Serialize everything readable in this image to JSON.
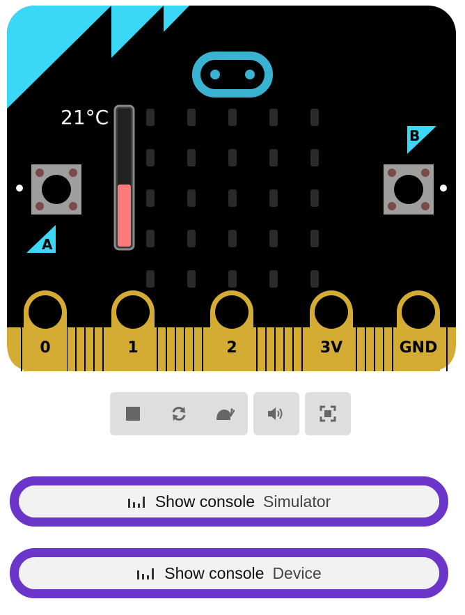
{
  "simulator": {
    "temperature_label": "21°C",
    "temperature_level": 0.45,
    "button_a_label": "A",
    "button_b_label": "B",
    "pins": [
      "0",
      "1",
      "2",
      "3V",
      "GND"
    ],
    "colors": {
      "board": "#000000",
      "accent": "#3ad7f6",
      "gold": "#d4ac33",
      "led_off": "#2a2a2a",
      "thermometer_fill": "#ff7b7b"
    }
  },
  "controls": {
    "stop": "stop-icon",
    "restart": "restart-icon",
    "slow_mo": "snail-icon",
    "mute": "speaker-icon",
    "fullscreen": "fullscreen-icon"
  },
  "console_simulator": {
    "title": "Show console",
    "source": "Simulator",
    "icon": "bar-chart-icon"
  },
  "console_device": {
    "title": "Show console",
    "source": "Device",
    "icon": "bar-chart-icon"
  }
}
